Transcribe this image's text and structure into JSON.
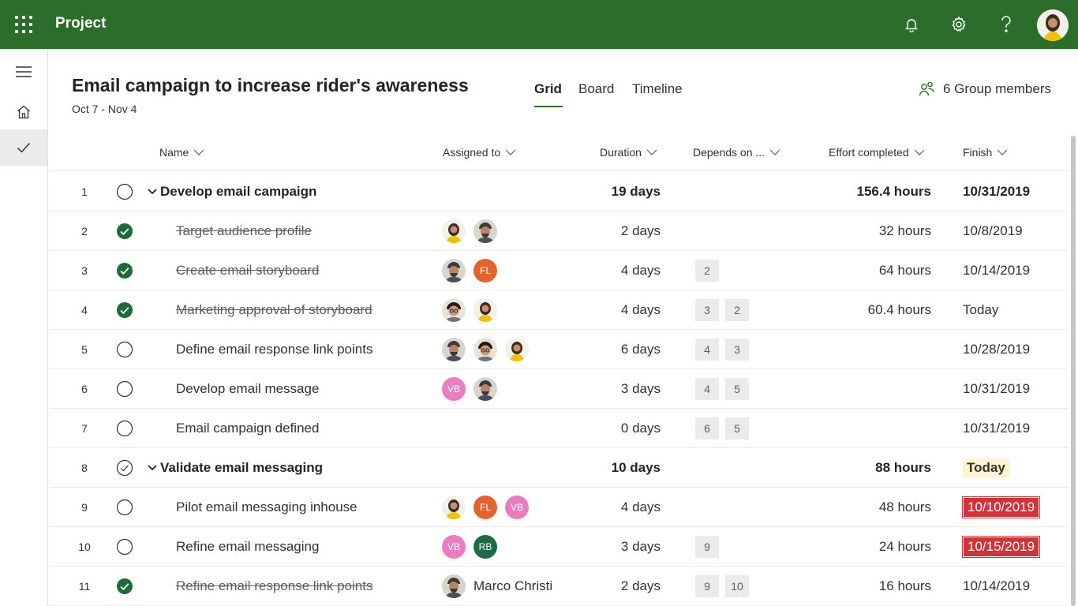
{
  "app": {
    "title": "Project"
  },
  "project": {
    "title": "Email campaign to increase rider's awareness",
    "dates": "Oct 7 - Nov 4",
    "members": "6 Group members"
  },
  "tabs": [
    "Grid",
    "Board",
    "Timeline"
  ],
  "columns": {
    "name": "Name",
    "assigned": "Assigned to",
    "duration": "Duration",
    "depends": "Depends on ...",
    "effort": "Effort completed",
    "finish": "Finish"
  },
  "colors": {
    "brand": "#2b6e2c",
    "late": "#d13438",
    "today": "#fff4ce",
    "complete": "#1e6b3a"
  },
  "avatars": {
    "FL": "#e3632d",
    "VB": "#e87dbf",
    "RB": "#1e6b45"
  },
  "rows": [
    {
      "num": "1",
      "name": "Develop email campaign",
      "duration": "19 days",
      "effort": "156.4 hours",
      "finish": "10/31/2019"
    },
    {
      "num": "2",
      "name": "Target audience profile",
      "duration": "2 days",
      "effort": "32 hours",
      "finish": "10/8/2019"
    },
    {
      "num": "3",
      "name": "Create email storyboard",
      "duration": "4 days",
      "deps": [
        "2"
      ],
      "effort": "64 hours",
      "finish": "10/14/2019",
      "init": [
        "FL"
      ]
    },
    {
      "num": "4",
      "name": "Marketing approval of storyboard",
      "duration": "4 days",
      "deps": [
        "3",
        "2"
      ],
      "effort": "60.4 hours",
      "finish": "Today"
    },
    {
      "num": "5",
      "name": "Define email response link points",
      "duration": "6 days",
      "deps": [
        "4",
        "3"
      ],
      "finish": "10/28/2019"
    },
    {
      "num": "6",
      "name": "Develop email message",
      "duration": "3 days",
      "deps": [
        "4",
        "5"
      ],
      "finish": "10/31/2019",
      "init": [
        "VB"
      ]
    },
    {
      "num": "7",
      "name": "Email campaign defined",
      "duration": "0 days",
      "deps": [
        "6",
        "5"
      ],
      "finish": "10/31/2019"
    },
    {
      "num": "8",
      "name": "Validate email messaging",
      "duration": "10 days",
      "effort": "88 hours",
      "finish": "Today"
    },
    {
      "num": "9",
      "name": "Pilot email messaging inhouse",
      "duration": "4 days",
      "effort": "48 hours",
      "finish": "10/10/2019",
      "init": [
        "FL",
        "VB"
      ]
    },
    {
      "num": "10",
      "name": "Refine email messaging",
      "duration": "3 days",
      "deps": [
        "9"
      ],
      "effort": "24 hours",
      "finish": "10/15/2019",
      "init": [
        "VB",
        "RB"
      ]
    },
    {
      "num": "11",
      "name": "Refine email response link points",
      "duration": "2 days",
      "deps": [
        "9",
        "10"
      ],
      "effort": "16 hours",
      "finish": "10/14/2019",
      "assignee": "Marco Christi"
    }
  ]
}
